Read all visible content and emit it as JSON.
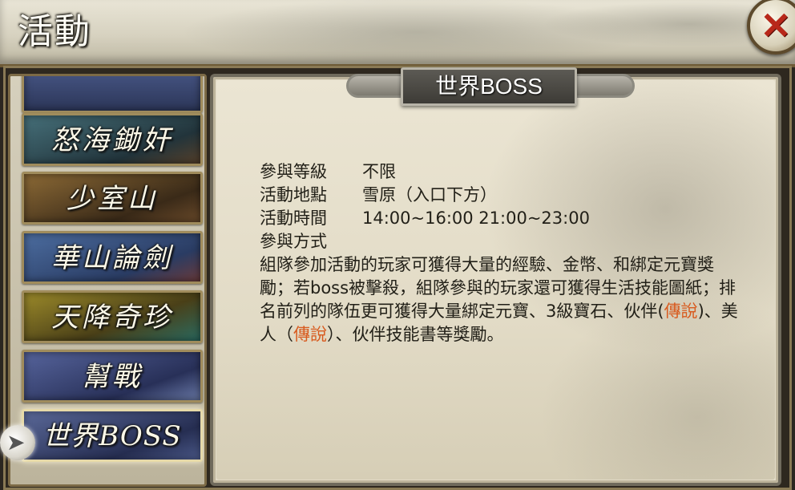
{
  "header": {
    "title": "活動",
    "close_icon": "close-icon"
  },
  "sidebar": {
    "items": [
      {
        "label": "",
        "bg": "#3d4a7a"
      },
      {
        "label": "怒海鋤奸",
        "bg": "#2f4e5a"
      },
      {
        "label": "少室山",
        "bg": "#6a5632"
      },
      {
        "label": "華山論劍",
        "bg": "#3f5a8a"
      },
      {
        "label": "天降奇珍",
        "bg": "#6b6a2a"
      },
      {
        "label": "幫戰",
        "bg": "#3d4a78"
      },
      {
        "label": "世界BOSS",
        "bg": "#36426e"
      }
    ],
    "selected_index": 6
  },
  "panel": {
    "title": "世界BOSS",
    "level_label": "參與等級",
    "level_value": "不限",
    "location_label": "活動地點",
    "location_value": "雪原（入口下方）",
    "time_label": "活動時間",
    "time_value": "14:00~16:00 21:00~23:00",
    "method_label": "參與方式",
    "desc_part1": "組隊參加活動的玩家可獲得大量的經驗、金幣、和綁定元寶獎勵；若boss被擊殺，組隊參與的玩家還可獲得生活技能圖紙；排名前列的隊伍更可獲得大量綁定元寶、3級寶石、伙伴(",
    "desc_hl1": "傳說",
    "desc_part2": ")、美人（",
    "desc_hl2": "傳說",
    "desc_part3": "）、伙伴技能書等獎勵。",
    "highlight_color": "#d85a1e"
  }
}
